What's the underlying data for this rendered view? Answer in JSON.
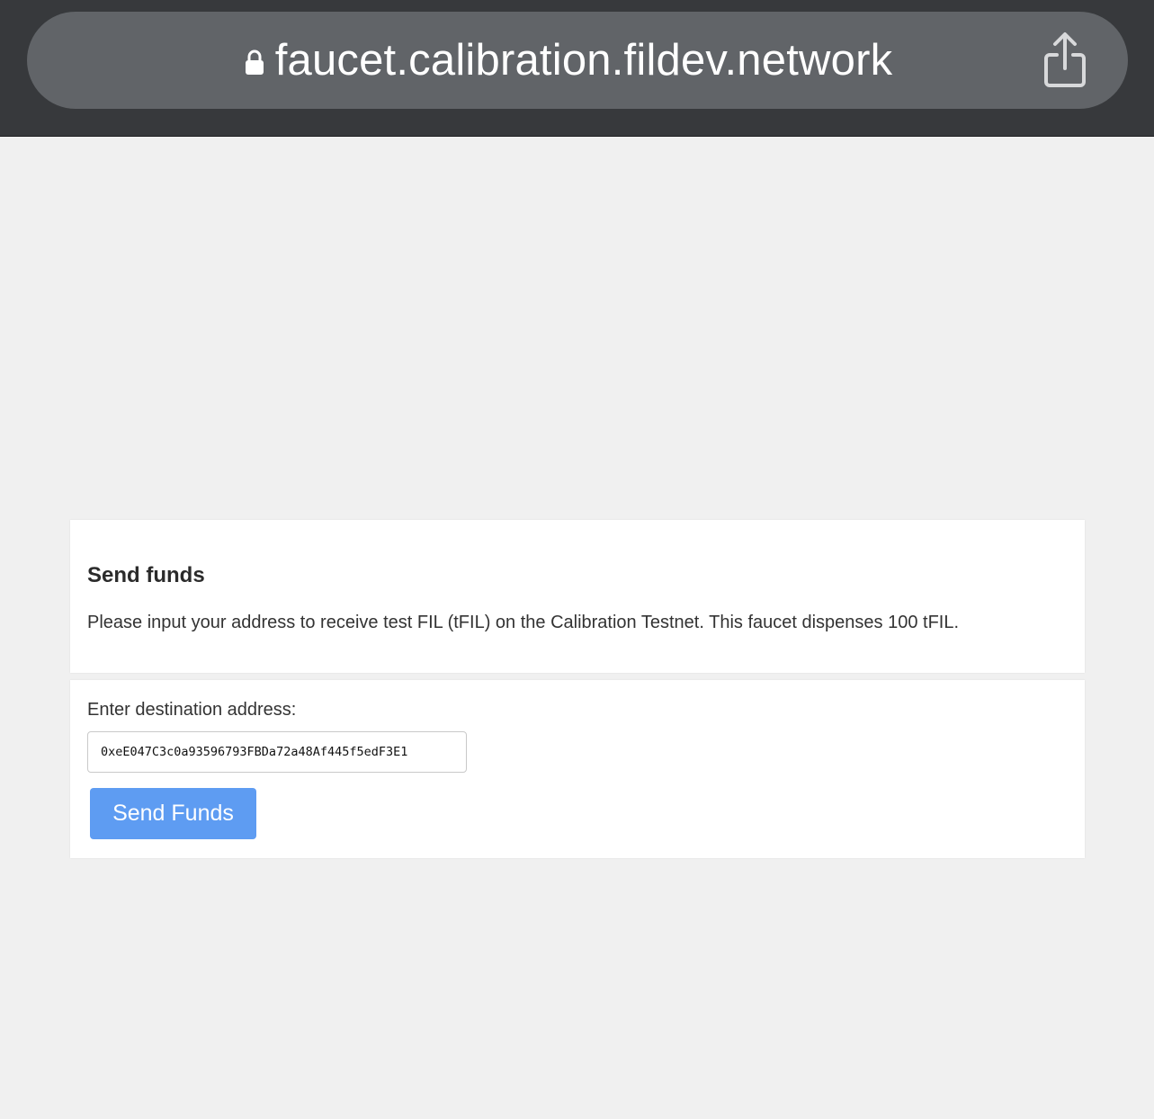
{
  "browser": {
    "url": "faucet.calibration.fildev.network",
    "lock_icon": "lock-icon",
    "share_icon": "share-icon"
  },
  "info_card": {
    "title": "Send funds",
    "description": "Please input your address to receive test FIL (tFIL) on the Calibration Testnet. This faucet dispenses 100 tFIL."
  },
  "form_card": {
    "label": "Enter destination address:",
    "address_value": "0xeE047C3c0a93596793FBDa72a48Af445f5edF3E1",
    "send_button_label": "Send Funds"
  },
  "colors": {
    "page_background": "#f0f0f0",
    "browser_chrome": "#37393c",
    "url_pill": "#616468",
    "button_accent": "#5e9cf2"
  }
}
